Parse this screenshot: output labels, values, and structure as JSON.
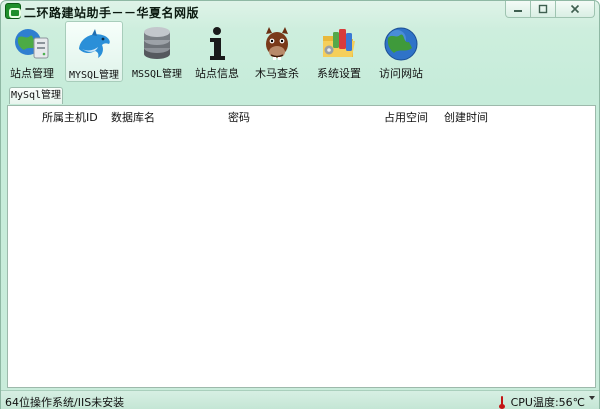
{
  "window": {
    "title": "二环路建站助手－－华夏名网版"
  },
  "toolbar": {
    "items": [
      {
        "label": "站点管理",
        "icon": "globe-server-icon",
        "active": false
      },
      {
        "label": "MYSQL管理",
        "icon": "mysql-dolphin-icon",
        "active": true
      },
      {
        "label": "MSSQL管理",
        "icon": "database-icon",
        "active": false
      },
      {
        "label": "站点信息",
        "icon": "info-icon",
        "active": false
      },
      {
        "label": "木马查杀",
        "icon": "trojan-horse-icon",
        "active": false
      },
      {
        "label": "系统设置",
        "icon": "settings-folder-icon",
        "active": false
      },
      {
        "label": "访问网站",
        "icon": "globe-icon",
        "active": false
      }
    ]
  },
  "tab": {
    "label": "MySql管理"
  },
  "table": {
    "columns": [
      "所属主机ID",
      "数据库名",
      "密码",
      "占用空间",
      "创建时间"
    ],
    "rows": []
  },
  "status": {
    "left": "64位操作系统/IIS未安装",
    "cpu_temp": "CPU温度:56℃"
  },
  "colors": {
    "window_bg": "#c9ecdb",
    "thermometer": "#c31515"
  }
}
